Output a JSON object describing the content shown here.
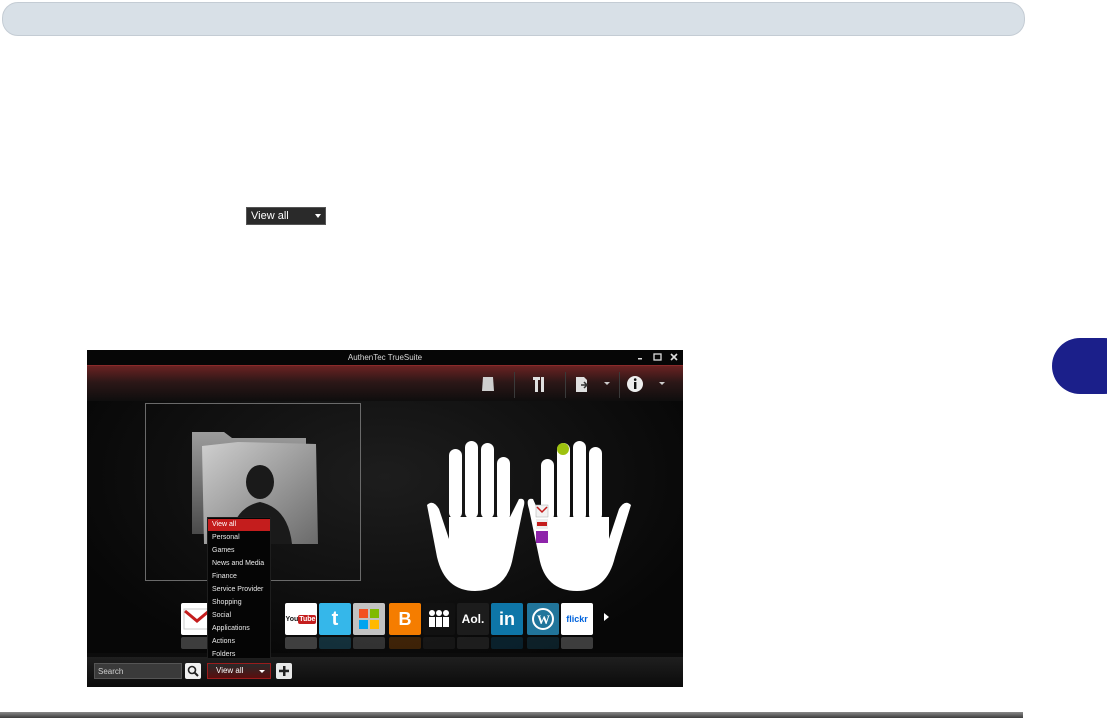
{
  "app": {
    "title": "AuthenTec TrueSuite",
    "window_controls": [
      "minimize",
      "maximize",
      "close"
    ]
  },
  "inline_dropdown": {
    "label": "View all"
  },
  "toolbar": {
    "icons": [
      "identity-icon",
      "tools-icon",
      "export-icon",
      "info-icon"
    ]
  },
  "search": {
    "placeholder": "Search"
  },
  "filter": {
    "selected": "View all",
    "options": [
      "View all",
      "Personal",
      "Games",
      "News and Media",
      "Finance",
      "Service Provider",
      "Shopping",
      "Social",
      "Applications",
      "Actions",
      "Folders"
    ]
  },
  "apps": [
    {
      "name": "gmail-icon",
      "label": "M",
      "color": "#ffffff"
    },
    {
      "name": "yahoo-icon",
      "label": "",
      "color": "#7b1fa2"
    },
    {
      "name": "youtube-icon",
      "label": "YouTube",
      "color": "#ffffff"
    },
    {
      "name": "twitter-icon",
      "label": "t",
      "color": "#35b7ea"
    },
    {
      "name": "windows-live-icon",
      "label": "",
      "color": "#c2c2c2"
    },
    {
      "name": "blogger-icon",
      "label": "B",
      "color": "#f57d00"
    },
    {
      "name": "myspace-icon",
      "label": "",
      "color": "#111111"
    },
    {
      "name": "aol-icon",
      "label": "Aol.",
      "color": "#1c1c1c"
    },
    {
      "name": "linkedin-icon",
      "label": "in",
      "color": "#0e76a8"
    },
    {
      "name": "wordpress-icon",
      "label": "W",
      "color": "#21759b"
    },
    {
      "name": "flickr-icon",
      "label": "flickr",
      "color": "#ffffff"
    }
  ],
  "colors": {
    "accent_red": "#c41d1d",
    "header_bar": "#d8e0e7",
    "chapter_tab": "#1b1f8a"
  }
}
